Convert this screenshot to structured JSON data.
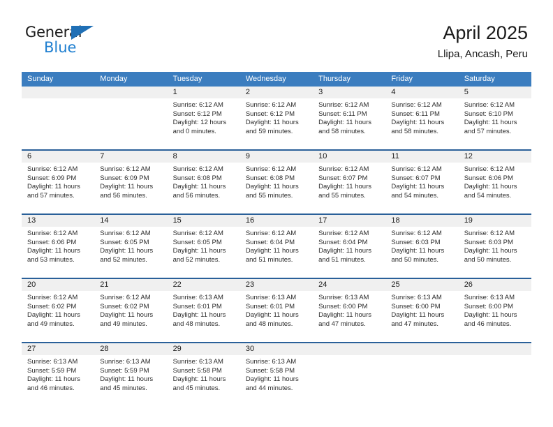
{
  "brand": {
    "name_top": "General",
    "name_bottom": "Blue",
    "triangle_icon": "blue-triangle-logo-mark",
    "color_dark": "#1a1a1a",
    "color_blue": "#1f7fd0"
  },
  "header": {
    "title": "April 2025",
    "subtitle": "Llipa, Ancash, Peru"
  },
  "theme": {
    "header_blue": "#3b7dbf",
    "divider_blue": "#2a6099",
    "daynum_band": "#f0f0f0",
    "text": "#1a1a1a"
  },
  "weekdays": [
    "Sunday",
    "Monday",
    "Tuesday",
    "Wednesday",
    "Thursday",
    "Friday",
    "Saturday"
  ],
  "weeks": [
    {
      "days": [
        {
          "number": "",
          "lines": []
        },
        {
          "number": "",
          "lines": []
        },
        {
          "number": "1",
          "lines": [
            "Sunrise: 6:12 AM",
            "Sunset: 6:12 PM",
            "Daylight: 12 hours",
            "and 0 minutes."
          ]
        },
        {
          "number": "2",
          "lines": [
            "Sunrise: 6:12 AM",
            "Sunset: 6:12 PM",
            "Daylight: 11 hours",
            "and 59 minutes."
          ]
        },
        {
          "number": "3",
          "lines": [
            "Sunrise: 6:12 AM",
            "Sunset: 6:11 PM",
            "Daylight: 11 hours",
            "and 58 minutes."
          ]
        },
        {
          "number": "4",
          "lines": [
            "Sunrise: 6:12 AM",
            "Sunset: 6:11 PM",
            "Daylight: 11 hours",
            "and 58 minutes."
          ]
        },
        {
          "number": "5",
          "lines": [
            "Sunrise: 6:12 AM",
            "Sunset: 6:10 PM",
            "Daylight: 11 hours",
            "and 57 minutes."
          ]
        }
      ]
    },
    {
      "days": [
        {
          "number": "6",
          "lines": [
            "Sunrise: 6:12 AM",
            "Sunset: 6:09 PM",
            "Daylight: 11 hours",
            "and 57 minutes."
          ]
        },
        {
          "number": "7",
          "lines": [
            "Sunrise: 6:12 AM",
            "Sunset: 6:09 PM",
            "Daylight: 11 hours",
            "and 56 minutes."
          ]
        },
        {
          "number": "8",
          "lines": [
            "Sunrise: 6:12 AM",
            "Sunset: 6:08 PM",
            "Daylight: 11 hours",
            "and 56 minutes."
          ]
        },
        {
          "number": "9",
          "lines": [
            "Sunrise: 6:12 AM",
            "Sunset: 6:08 PM",
            "Daylight: 11 hours",
            "and 55 minutes."
          ]
        },
        {
          "number": "10",
          "lines": [
            "Sunrise: 6:12 AM",
            "Sunset: 6:07 PM",
            "Daylight: 11 hours",
            "and 55 minutes."
          ]
        },
        {
          "number": "11",
          "lines": [
            "Sunrise: 6:12 AM",
            "Sunset: 6:07 PM",
            "Daylight: 11 hours",
            "and 54 minutes."
          ]
        },
        {
          "number": "12",
          "lines": [
            "Sunrise: 6:12 AM",
            "Sunset: 6:06 PM",
            "Daylight: 11 hours",
            "and 54 minutes."
          ]
        }
      ]
    },
    {
      "days": [
        {
          "number": "13",
          "lines": [
            "Sunrise: 6:12 AM",
            "Sunset: 6:06 PM",
            "Daylight: 11 hours",
            "and 53 minutes."
          ]
        },
        {
          "number": "14",
          "lines": [
            "Sunrise: 6:12 AM",
            "Sunset: 6:05 PM",
            "Daylight: 11 hours",
            "and 52 minutes."
          ]
        },
        {
          "number": "15",
          "lines": [
            "Sunrise: 6:12 AM",
            "Sunset: 6:05 PM",
            "Daylight: 11 hours",
            "and 52 minutes."
          ]
        },
        {
          "number": "16",
          "lines": [
            "Sunrise: 6:12 AM",
            "Sunset: 6:04 PM",
            "Daylight: 11 hours",
            "and 51 minutes."
          ]
        },
        {
          "number": "17",
          "lines": [
            "Sunrise: 6:12 AM",
            "Sunset: 6:04 PM",
            "Daylight: 11 hours",
            "and 51 minutes."
          ]
        },
        {
          "number": "18",
          "lines": [
            "Sunrise: 6:12 AM",
            "Sunset: 6:03 PM",
            "Daylight: 11 hours",
            "and 50 minutes."
          ]
        },
        {
          "number": "19",
          "lines": [
            "Sunrise: 6:12 AM",
            "Sunset: 6:03 PM",
            "Daylight: 11 hours",
            "and 50 minutes."
          ]
        }
      ]
    },
    {
      "days": [
        {
          "number": "20",
          "lines": [
            "Sunrise: 6:12 AM",
            "Sunset: 6:02 PM",
            "Daylight: 11 hours",
            "and 49 minutes."
          ]
        },
        {
          "number": "21",
          "lines": [
            "Sunrise: 6:12 AM",
            "Sunset: 6:02 PM",
            "Daylight: 11 hours",
            "and 49 minutes."
          ]
        },
        {
          "number": "22",
          "lines": [
            "Sunrise: 6:13 AM",
            "Sunset: 6:01 PM",
            "Daylight: 11 hours",
            "and 48 minutes."
          ]
        },
        {
          "number": "23",
          "lines": [
            "Sunrise: 6:13 AM",
            "Sunset: 6:01 PM",
            "Daylight: 11 hours",
            "and 48 minutes."
          ]
        },
        {
          "number": "24",
          "lines": [
            "Sunrise: 6:13 AM",
            "Sunset: 6:00 PM",
            "Daylight: 11 hours",
            "and 47 minutes."
          ]
        },
        {
          "number": "25",
          "lines": [
            "Sunrise: 6:13 AM",
            "Sunset: 6:00 PM",
            "Daylight: 11 hours",
            "and 47 minutes."
          ]
        },
        {
          "number": "26",
          "lines": [
            "Sunrise: 6:13 AM",
            "Sunset: 6:00 PM",
            "Daylight: 11 hours",
            "and 46 minutes."
          ]
        }
      ]
    },
    {
      "days": [
        {
          "number": "27",
          "lines": [
            "Sunrise: 6:13 AM",
            "Sunset: 5:59 PM",
            "Daylight: 11 hours",
            "and 46 minutes."
          ]
        },
        {
          "number": "28",
          "lines": [
            "Sunrise: 6:13 AM",
            "Sunset: 5:59 PM",
            "Daylight: 11 hours",
            "and 45 minutes."
          ]
        },
        {
          "number": "29",
          "lines": [
            "Sunrise: 6:13 AM",
            "Sunset: 5:58 PM",
            "Daylight: 11 hours",
            "and 45 minutes."
          ]
        },
        {
          "number": "30",
          "lines": [
            "Sunrise: 6:13 AM",
            "Sunset: 5:58 PM",
            "Daylight: 11 hours",
            "and 44 minutes."
          ]
        },
        {
          "number": "",
          "lines": []
        },
        {
          "number": "",
          "lines": []
        },
        {
          "number": "",
          "lines": []
        }
      ]
    }
  ]
}
